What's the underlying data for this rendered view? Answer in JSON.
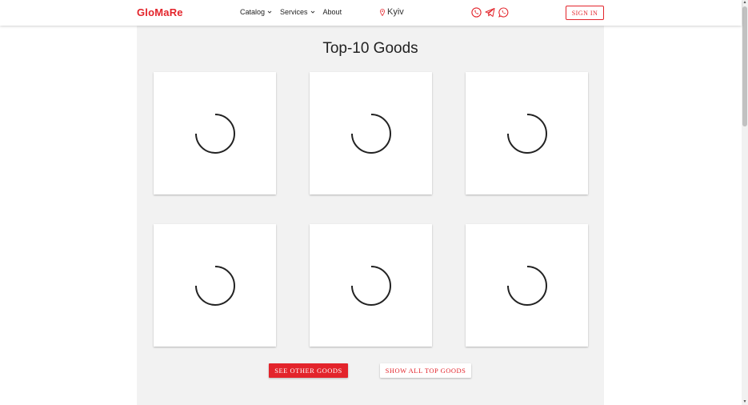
{
  "header": {
    "logo": "GloMaRe",
    "nav": [
      {
        "label": "Catalog",
        "has_dropdown": true
      },
      {
        "label": "Services",
        "has_dropdown": true
      },
      {
        "label": "About",
        "has_dropdown": false
      }
    ],
    "location": "Kyiv",
    "location_icon": "map-pin-icon",
    "socials": [
      "viber-icon",
      "telegram-icon",
      "whatsapp-icon"
    ],
    "sign_in_label": "SIGN IN"
  },
  "main": {
    "title": "Top-10 Goods",
    "cards_count_visible": 6,
    "see_other_label": "SEE OTHER GOODS",
    "show_all_label": "SHOW ALL TOP GOODS"
  },
  "colors": {
    "accent": "#e3242b",
    "content_bg": "#f2f2f2",
    "card_bg": "#ffffff",
    "spinner": "#222222"
  }
}
